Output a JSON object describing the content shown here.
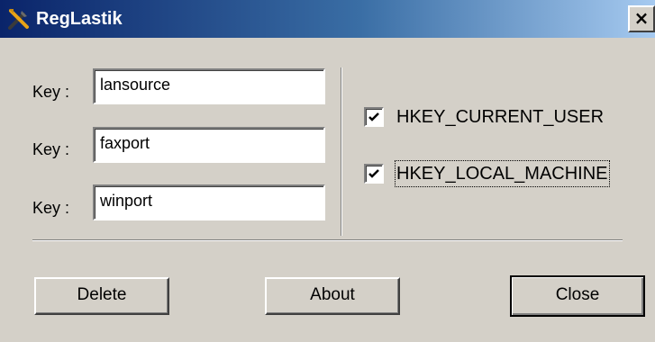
{
  "window": {
    "title": "RegLastik",
    "close_label": "×"
  },
  "keys": [
    {
      "label": "Key :",
      "value": "lansource"
    },
    {
      "label": "Key :",
      "value": "faxport"
    },
    {
      "label": "Key :",
      "value": "winport"
    }
  ],
  "hives": [
    {
      "label": "HKEY_CURRENT_USER",
      "checked": true
    },
    {
      "label": "HKEY_LOCAL_MACHINE",
      "checked": true,
      "focused": true
    }
  ],
  "buttons": {
    "delete_label": "Delete",
    "about_label": "About",
    "close_label": "Close"
  },
  "colors": {
    "titlebar_start": "#0a246a",
    "titlebar_end": "#a6caf0",
    "face": "#d4d0c8"
  },
  "icons": {
    "app": "tools-icon",
    "close": "close-icon",
    "check": "checkmark-icon"
  }
}
